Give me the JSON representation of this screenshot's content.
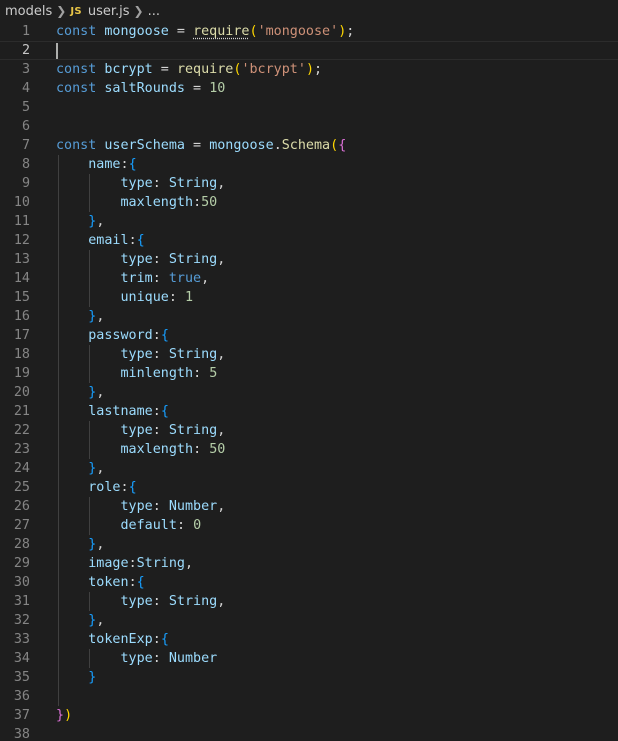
{
  "breadcrumb": {
    "folder": "models",
    "file_icon": "JS",
    "file": "user.js",
    "more": "..."
  },
  "colors": {
    "background": "#1e1e1e",
    "line_number": "#858585",
    "keyword": "#569cd6",
    "variable": "#9cdcfe",
    "function": "#dcdcaa",
    "string": "#ce9178",
    "number": "#b5cea8",
    "bracket_level1": "#ffd700",
    "bracket_level2": "#da70d6",
    "bracket_level3": "#179fff"
  },
  "editor": {
    "current_line": 2,
    "lines": [
      {
        "n": "1",
        "tokens": [
          [
            "kw",
            "const"
          ],
          [
            "plain",
            " "
          ],
          [
            "var",
            "mongoose"
          ],
          [
            "plain",
            " = "
          ],
          [
            "fnsq",
            "require"
          ],
          [
            "b1",
            "("
          ],
          [
            "str",
            "'mongoose'"
          ],
          [
            "b1",
            ")"
          ],
          [
            "plain",
            ";"
          ]
        ]
      },
      {
        "n": "2",
        "tokens": []
      },
      {
        "n": "3",
        "tokens": [
          [
            "kw",
            "const"
          ],
          [
            "plain",
            " "
          ],
          [
            "var",
            "bcrypt"
          ],
          [
            "plain",
            " = "
          ],
          [
            "fn",
            "require"
          ],
          [
            "b1",
            "("
          ],
          [
            "str",
            "'bcrypt'"
          ],
          [
            "b1",
            ")"
          ],
          [
            "plain",
            ";"
          ]
        ]
      },
      {
        "n": "4",
        "tokens": [
          [
            "kw",
            "const"
          ],
          [
            "plain",
            " "
          ],
          [
            "var",
            "saltRounds"
          ],
          [
            "plain",
            " = "
          ],
          [
            "num",
            "10"
          ]
        ]
      },
      {
        "n": "5",
        "tokens": []
      },
      {
        "n": "6",
        "tokens": []
      },
      {
        "n": "7",
        "tokens": [
          [
            "kw",
            "const"
          ],
          [
            "plain",
            " "
          ],
          [
            "var",
            "userSchema"
          ],
          [
            "plain",
            " = "
          ],
          [
            "var",
            "mongoose"
          ],
          [
            "plain",
            "."
          ],
          [
            "fn",
            "Schema"
          ],
          [
            "b1",
            "("
          ],
          [
            "b2",
            "{"
          ]
        ]
      },
      {
        "n": "8",
        "tokens": [
          [
            "plain",
            "    "
          ],
          [
            "var",
            "name"
          ],
          [
            "plain",
            ":"
          ],
          [
            "b3",
            "{"
          ]
        ]
      },
      {
        "n": "9",
        "tokens": [
          [
            "plain",
            "        "
          ],
          [
            "var",
            "type"
          ],
          [
            "plain",
            ": "
          ],
          [
            "var",
            "String"
          ],
          [
            "plain",
            ","
          ]
        ]
      },
      {
        "n": "10",
        "tokens": [
          [
            "plain",
            "        "
          ],
          [
            "var",
            "maxlength"
          ],
          [
            "plain",
            ":"
          ],
          [
            "num",
            "50"
          ]
        ]
      },
      {
        "n": "11",
        "tokens": [
          [
            "plain",
            "    "
          ],
          [
            "b3",
            "}"
          ],
          [
            "plain",
            ","
          ]
        ]
      },
      {
        "n": "12",
        "tokens": [
          [
            "plain",
            "    "
          ],
          [
            "var",
            "email"
          ],
          [
            "plain",
            ":"
          ],
          [
            "b3",
            "{"
          ]
        ]
      },
      {
        "n": "13",
        "tokens": [
          [
            "plain",
            "        "
          ],
          [
            "var",
            "type"
          ],
          [
            "plain",
            ": "
          ],
          [
            "var",
            "String"
          ],
          [
            "plain",
            ","
          ]
        ]
      },
      {
        "n": "14",
        "tokens": [
          [
            "plain",
            "        "
          ],
          [
            "var",
            "trim"
          ],
          [
            "plain",
            ": "
          ],
          [
            "kw",
            "true"
          ],
          [
            "plain",
            ","
          ]
        ]
      },
      {
        "n": "15",
        "tokens": [
          [
            "plain",
            "        "
          ],
          [
            "var",
            "unique"
          ],
          [
            "plain",
            ": "
          ],
          [
            "num",
            "1"
          ]
        ]
      },
      {
        "n": "16",
        "tokens": [
          [
            "plain",
            "    "
          ],
          [
            "b3",
            "}"
          ],
          [
            "plain",
            ","
          ]
        ]
      },
      {
        "n": "17",
        "tokens": [
          [
            "plain",
            "    "
          ],
          [
            "var",
            "password"
          ],
          [
            "plain",
            ":"
          ],
          [
            "b3",
            "{"
          ]
        ]
      },
      {
        "n": "18",
        "tokens": [
          [
            "plain",
            "        "
          ],
          [
            "var",
            "type"
          ],
          [
            "plain",
            ": "
          ],
          [
            "var",
            "String"
          ],
          [
            "plain",
            ","
          ]
        ]
      },
      {
        "n": "19",
        "tokens": [
          [
            "plain",
            "        "
          ],
          [
            "var",
            "minlength"
          ],
          [
            "plain",
            ": "
          ],
          [
            "num",
            "5"
          ]
        ]
      },
      {
        "n": "20",
        "tokens": [
          [
            "plain",
            "    "
          ],
          [
            "b3",
            "}"
          ],
          [
            "plain",
            ","
          ]
        ]
      },
      {
        "n": "21",
        "tokens": [
          [
            "plain",
            "    "
          ],
          [
            "var",
            "lastname"
          ],
          [
            "plain",
            ":"
          ],
          [
            "b3",
            "{"
          ]
        ]
      },
      {
        "n": "22",
        "tokens": [
          [
            "plain",
            "        "
          ],
          [
            "var",
            "type"
          ],
          [
            "plain",
            ": "
          ],
          [
            "var",
            "String"
          ],
          [
            "plain",
            ","
          ]
        ]
      },
      {
        "n": "23",
        "tokens": [
          [
            "plain",
            "        "
          ],
          [
            "var",
            "maxlength"
          ],
          [
            "plain",
            ": "
          ],
          [
            "num",
            "50"
          ]
        ]
      },
      {
        "n": "24",
        "tokens": [
          [
            "plain",
            "    "
          ],
          [
            "b3",
            "}"
          ],
          [
            "plain",
            ","
          ]
        ]
      },
      {
        "n": "25",
        "tokens": [
          [
            "plain",
            "    "
          ],
          [
            "var",
            "role"
          ],
          [
            "plain",
            ":"
          ],
          [
            "b3",
            "{"
          ]
        ]
      },
      {
        "n": "26",
        "tokens": [
          [
            "plain",
            "        "
          ],
          [
            "var",
            "type"
          ],
          [
            "plain",
            ": "
          ],
          [
            "var",
            "Number"
          ],
          [
            "plain",
            ","
          ]
        ]
      },
      {
        "n": "27",
        "tokens": [
          [
            "plain",
            "        "
          ],
          [
            "var",
            "default"
          ],
          [
            "plain",
            ": "
          ],
          [
            "num",
            "0"
          ]
        ]
      },
      {
        "n": "28",
        "tokens": [
          [
            "plain",
            "    "
          ],
          [
            "b3",
            "}"
          ],
          [
            "plain",
            ","
          ]
        ]
      },
      {
        "n": "29",
        "tokens": [
          [
            "plain",
            "    "
          ],
          [
            "var",
            "image"
          ],
          [
            "plain",
            ":"
          ],
          [
            "var",
            "String"
          ],
          [
            "plain",
            ","
          ]
        ]
      },
      {
        "n": "30",
        "tokens": [
          [
            "plain",
            "    "
          ],
          [
            "var",
            "token"
          ],
          [
            "plain",
            ":"
          ],
          [
            "b3",
            "{"
          ]
        ]
      },
      {
        "n": "31",
        "tokens": [
          [
            "plain",
            "        "
          ],
          [
            "var",
            "type"
          ],
          [
            "plain",
            ": "
          ],
          [
            "var",
            "String"
          ],
          [
            "plain",
            ","
          ]
        ]
      },
      {
        "n": "32",
        "tokens": [
          [
            "plain",
            "    "
          ],
          [
            "b3",
            "}"
          ],
          [
            "plain",
            ","
          ]
        ]
      },
      {
        "n": "33",
        "tokens": [
          [
            "plain",
            "    "
          ],
          [
            "var",
            "tokenExp"
          ],
          [
            "plain",
            ":"
          ],
          [
            "b3",
            "{"
          ]
        ]
      },
      {
        "n": "34",
        "tokens": [
          [
            "plain",
            "        "
          ],
          [
            "var",
            "type"
          ],
          [
            "plain",
            ": "
          ],
          [
            "var",
            "Number"
          ]
        ]
      },
      {
        "n": "35",
        "tokens": [
          [
            "plain",
            "    "
          ],
          [
            "b3",
            "}"
          ]
        ]
      },
      {
        "n": "36",
        "tokens": []
      },
      {
        "n": "37",
        "tokens": [
          [
            "b2",
            "}"
          ],
          [
            "b1",
            ")"
          ]
        ]
      },
      {
        "n": "38",
        "tokens": []
      }
    ]
  }
}
